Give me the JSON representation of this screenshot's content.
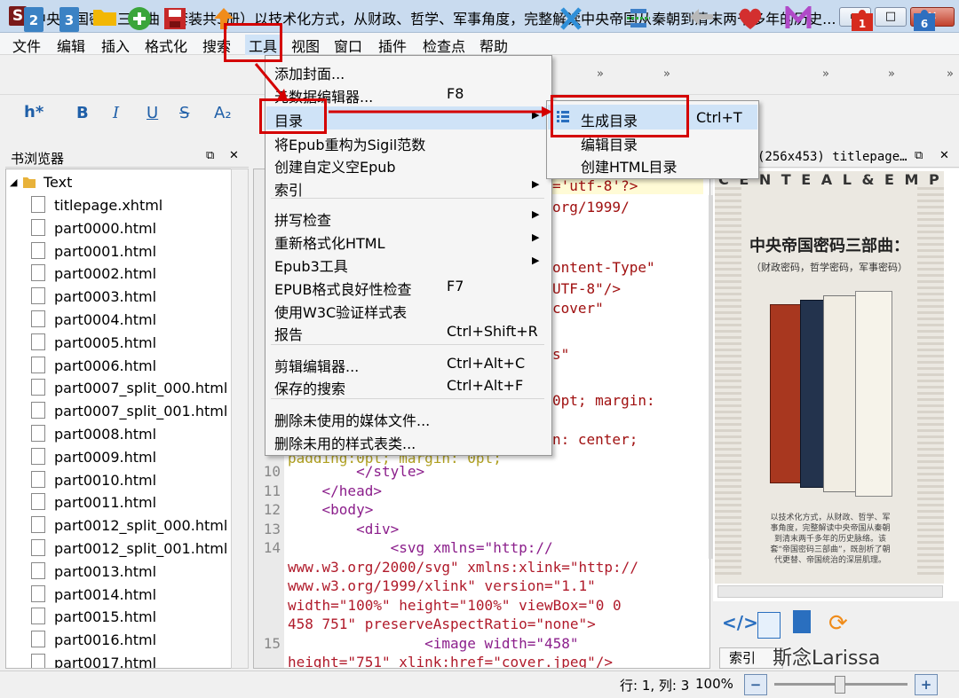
{
  "window": {
    "title": "中央帝国密码三部曲（套装共3册）以技术化方式，从财政、哲学、军事角度，完整解读中央帝国从秦朝到清末两千多年的历史...",
    "app_icon": "S",
    "min_glyph": "▭",
    "max_glyph": "□",
    "close_glyph": "✕"
  },
  "menubar": [
    "文件",
    "编辑",
    "插入",
    "格式化",
    "搜索",
    "工具",
    "视图",
    "窗口",
    "插件",
    "检查点",
    "帮助"
  ],
  "toolbar": {
    "doc2": "2",
    "doc3": "3",
    "heading": "h*",
    "bold": "B",
    "italic": "I",
    "underline": "U",
    "strike": "S",
    "subscript": "A₂",
    "overflow": "»",
    "badge1": "1",
    "badge6": "6"
  },
  "book_browser": {
    "title": "书浏览器",
    "folder": "Text",
    "files": [
      "titlepage.xhtml",
      "part0000.html",
      "part0001.html",
      "part0002.html",
      "part0003.html",
      "part0004.html",
      "part0005.html",
      "part0006.html",
      "part0007_split_000.html",
      "part0007_split_001.html",
      "part0008.html",
      "part0009.html",
      "part0010.html",
      "part0011.html",
      "part0012_split_000.html",
      "part0012_split_001.html",
      "part0013.html",
      "part0014.html",
      "part0015.html",
      "part0016.html",
      "part0017.html"
    ]
  },
  "editor": {
    "partial_lines": [
      "='utf-8'?>",
      "org/1999/",
      "ontent-Type\"",
      "UTF-8\"/>",
      "cover\"",
      "s\"",
      "0pt; margin:",
      "n: center;",
      "padding:0pt; margin: 0pt;"
    ],
    "lines": [
      {
        "n": "10",
        "code": "        </style>"
      },
      {
        "n": "11",
        "code": "    </head>"
      },
      {
        "n": "12",
        "code": "    <body>"
      },
      {
        "n": "13",
        "code": "        <div>"
      },
      {
        "n": "14",
        "code": "            <svg xmlns=\"http://"
      },
      {
        "n": "",
        "code": "www.w3.org/2000/svg\" xmlns:xlink=\"http://"
      },
      {
        "n": "",
        "code": "www.w3.org/1999/xlink\" version=\"1.1\""
      },
      {
        "n": "",
        "code": "width=\"100%\" height=\"100%\" viewBox=\"0 0"
      },
      {
        "n": "",
        "code": "458 751\" preserveAspectRatio=\"none\">"
      },
      {
        "n": "15",
        "code": "                <image width=\"458\""
      },
      {
        "n": "",
        "code": "height=\"751\" xlink:href=\"cover.jpeg\"/>"
      }
    ]
  },
  "preview": {
    "header": "(256x453) titlepage…",
    "cover_top_text": "C E N T E A L & E M P I R",
    "cover_title": "中央帝国密码三部曲：",
    "cover_subtitle": "（财政密码，哲学密码，军事密码）",
    "cover_blurb": "以技术化方式，从财政、哲学、军事角度，完整解读中央帝国从秦朝到清末两千多年的历史脉络。该套“帝国密码三部曲”，既剖析了朝代更替、帝国统治的深层肌理。",
    "tab_label": "索引"
  },
  "tools_menu": {
    "items": [
      {
        "label": "添加封面...",
        "shortcut": "",
        "submenu": false
      },
      {
        "label": "元数据编辑器...",
        "shortcut": "F8",
        "submenu": false
      },
      {
        "label": "目录",
        "shortcut": "",
        "submenu": true
      },
      {
        "label": "将Epub重构为Sigil范数",
        "shortcut": "",
        "submenu": false
      },
      {
        "label": "创建自定义空Epub",
        "shortcut": "",
        "submenu": false
      },
      {
        "label": "索引",
        "shortcut": "",
        "submenu": true
      },
      {
        "label": "拼写检查",
        "shortcut": "",
        "submenu": true
      },
      {
        "label": "重新格式化HTML",
        "shortcut": "",
        "submenu": true
      },
      {
        "label": "Epub3工具",
        "shortcut": "",
        "submenu": true
      },
      {
        "label": "EPUB格式良好性检查",
        "shortcut": "F7",
        "submenu": false
      },
      {
        "label": "使用W3C验证样式表",
        "shortcut": "",
        "submenu": false
      },
      {
        "label": "报告",
        "shortcut": "Ctrl+Shift+R",
        "submenu": false
      },
      {
        "label": "剪辑编辑器...",
        "shortcut": "Ctrl+Alt+C",
        "submenu": false
      },
      {
        "label": "保存的搜索",
        "shortcut": "Ctrl+Alt+F",
        "submenu": false
      },
      {
        "label": "删除未使用的媒体文件...",
        "shortcut": "",
        "submenu": false
      },
      {
        "label": "删除未用的样式表类...",
        "shortcut": "",
        "submenu": false
      }
    ]
  },
  "toc_submenu": {
    "items": [
      {
        "label": "生成目录",
        "shortcut": "Ctrl+T"
      },
      {
        "label": "编辑目录",
        "shortcut": ""
      },
      {
        "label": "创建HTML目录",
        "shortcut": ""
      }
    ]
  },
  "statusbar": {
    "position": "行: 1, 列: 3",
    "zoom": "100%",
    "zoom_out": "−",
    "zoom_in": "+"
  },
  "watermark": "斯念Larissa",
  "colors": {
    "highlight_red": "#d40000",
    "menu_hover": "#cfe3f7",
    "title_bar": "#c9dbef"
  }
}
